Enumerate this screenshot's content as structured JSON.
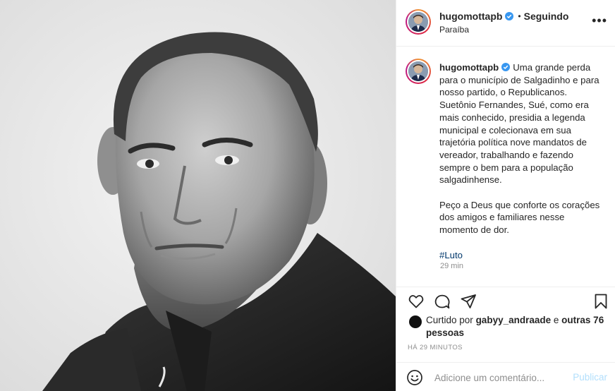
{
  "post": {
    "username": "hugomottapb",
    "following_label": "Seguindo",
    "separator": "•",
    "location": "Paraíba",
    "more_label": "•••"
  },
  "caption": {
    "username": "hugomottapb",
    "paragraph1": "Uma grande perda para o município de Salgadinho e para nosso partido, o Republicanos. Suetônio Fernandes, Sué, como era mais conhecido, presidia a legenda municipal e colecionava em sua trajetória política nove mandatos de vereador, trabalhando e fazendo sempre o bem para a população salgadinhense.",
    "paragraph2": "Peço a Deus que conforte os corações dos amigos e familiares nesse momento de dor.",
    "hashtag": "#Luto",
    "time": "29 min"
  },
  "likes": {
    "prefix": "Curtido por",
    "liker": "gabyy_andraade",
    "conjunction": "e",
    "others": "outras 76 pessoas"
  },
  "timeago": "HÁ 29 MINUTOS",
  "comment": {
    "placeholder": "Adicione um comentário...",
    "publish_label": "Publicar"
  },
  "icons": {
    "like": "heart-icon",
    "comment": "comment-icon",
    "share": "share-icon",
    "save": "bookmark-icon",
    "emoji": "emoji-icon",
    "verified": "verified-badge-icon"
  },
  "colors": {
    "verified_blue": "#3897f0",
    "hashtag": "#00376b",
    "muted": "#8e8e8e",
    "publish_disabled": "#b2dffc"
  }
}
